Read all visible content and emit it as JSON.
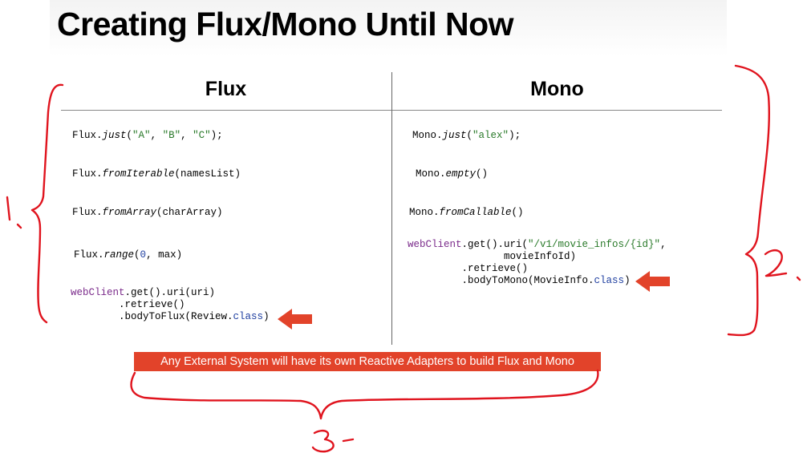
{
  "title": "Creating Flux/Mono Until Now",
  "columns": {
    "flux": "Flux",
    "mono": "Mono"
  },
  "flux": {
    "just_obj": "Flux.",
    "just_m": "just",
    "just_open": "(",
    "just_a": "\"A\"",
    "just_b": "\"B\"",
    "just_c": "\"C\"",
    "just_close": ");",
    "sep": ", ",
    "iter_obj": "Flux.",
    "iter_m": "fromIterable",
    "iter_args": "(namesList)",
    "arr_obj": "Flux.",
    "arr_m": "fromArray",
    "arr_args": "(charArray)",
    "range_obj": "Flux.",
    "range_m": "range",
    "range_open": "(",
    "range_zero": "0",
    "range_rest": ", max)",
    "wc": "webClient",
    "wc_l1": ".get().uri(uri)",
    "wc_l2": "        .retrieve()",
    "wc_l3a": "        .bodyToFlux(Review.",
    "wc_l3b": "class",
    "wc_l3c": ")"
  },
  "mono": {
    "just_obj": "Mono.",
    "just_m": "just",
    "just_open": "(",
    "just_s": "\"alex\"",
    "just_close": ");",
    "empty_obj": "Mono.",
    "empty_m": "empty",
    "empty_args": "()",
    "call_obj": "Mono.",
    "call_m": "fromCallable",
    "call_args": "()",
    "wc": "webClient",
    "wc_l1a": ".get().uri(",
    "wc_l1b": "\"/v1/movie_infos/{id}\"",
    "wc_l1c": ",",
    "wc_l2": "                movieInfoId)",
    "wc_l3": "         .retrieve()",
    "wc_l4a": "         .bodyToMono(MovieInfo.",
    "wc_l4b": "class",
    "wc_l4c": ")"
  },
  "banner": "Any External System will have its own Reactive Adapters to build Flux and Mono",
  "annotations": {
    "left": "1.",
    "right": "2.",
    "bottom": "3-"
  },
  "colors": {
    "accent": "#e2432a",
    "ink": "#e0141e",
    "string": "#2a7a2a",
    "keyword": "#7a2a8a",
    "number": "#1f3fa0"
  }
}
